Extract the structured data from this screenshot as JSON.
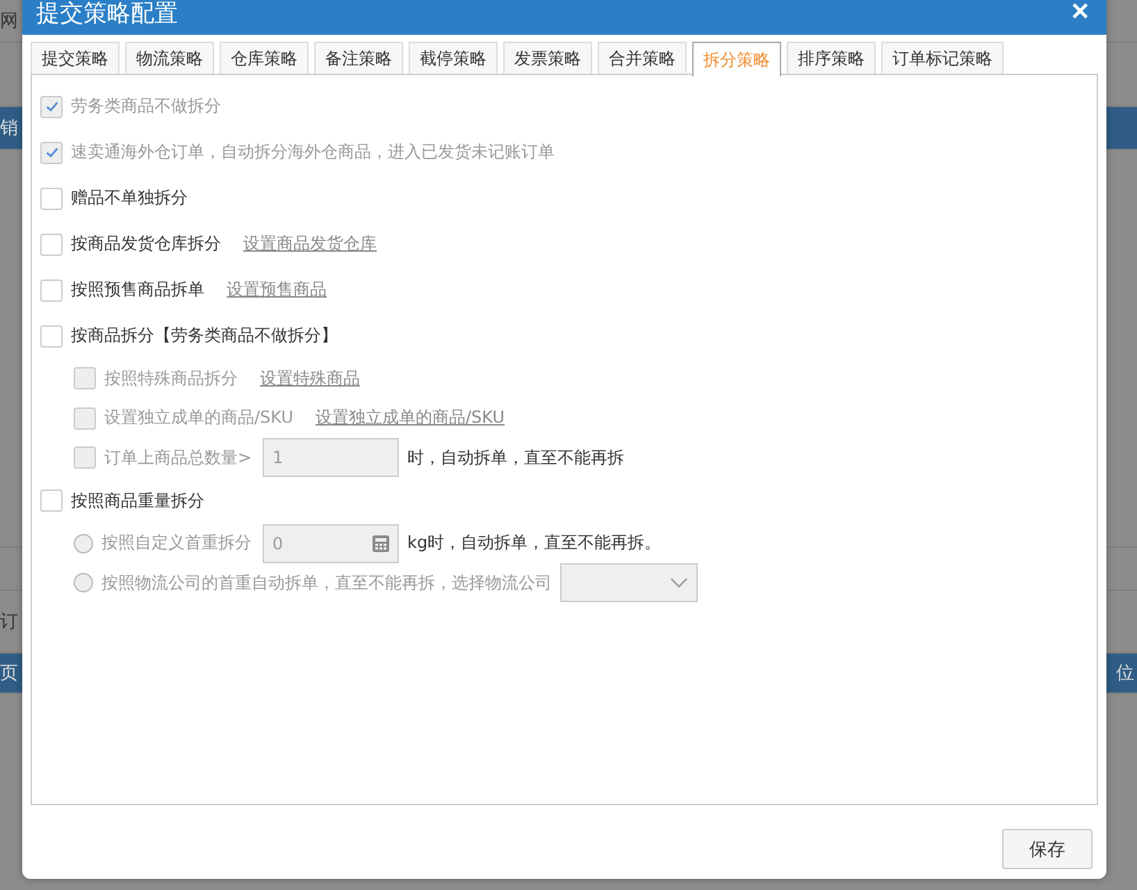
{
  "background": {
    "left_texts": [
      "网",
      "销",
      "订",
      "页"
    ],
    "right_texts": [
      "位"
    ]
  },
  "dialog": {
    "title": "提交策略配置",
    "close": "✕",
    "tabs": [
      {
        "label": "提交策略",
        "selected": false
      },
      {
        "label": "物流策略",
        "selected": false
      },
      {
        "label": "仓库策略",
        "selected": false
      },
      {
        "label": "备注策略",
        "selected": false
      },
      {
        "label": "截停策略",
        "selected": false
      },
      {
        "label": "发票策略",
        "selected": false
      },
      {
        "label": "合并策略",
        "selected": false
      },
      {
        "label": "拆分策略",
        "selected": true
      },
      {
        "label": "排序策略",
        "selected": false
      },
      {
        "label": "订单标记策略",
        "selected": false
      }
    ],
    "options": [
      {
        "kind": "checkbox",
        "label": "劳务类商品不做拆分",
        "checked": true,
        "disabled": true
      },
      {
        "kind": "checkbox",
        "label": "速卖通海外仓订单，自动拆分海外仓商品，进入已发货未记账订单",
        "checked": true,
        "disabled": true
      },
      {
        "kind": "checkbox",
        "label": "赠品不单独拆分",
        "checked": false,
        "disabled": false
      },
      {
        "kind": "checkbox",
        "label": "按商品发货仓库拆分",
        "checked": false,
        "disabled": false,
        "link": "设置商品发货仓库"
      },
      {
        "kind": "checkbox",
        "label": "按照预售商品拆单",
        "checked": false,
        "disabled": false,
        "link": "设置预售商品"
      },
      {
        "kind": "checkbox",
        "label": "按商品拆分【劳务类商品不做拆分】",
        "checked": false,
        "disabled": false,
        "children": [
          {
            "kind": "checkbox",
            "label": "按照特殊商品拆分",
            "checked": false,
            "disabled": true,
            "link": "设置特殊商品"
          },
          {
            "kind": "checkbox",
            "label": "设置独立成单的商品/SKU",
            "checked": false,
            "disabled": true,
            "link": "设置独立成单的商品/SKU"
          },
          {
            "kind": "checkbox",
            "label": "订单上商品总数量>",
            "checked": false,
            "disabled": true,
            "input": {
              "value": "1",
              "calculator": false
            },
            "suffix": "时，自动拆单，直至不能再拆"
          }
        ]
      },
      {
        "kind": "checkbox",
        "label": "按照商品重量拆分",
        "checked": false,
        "disabled": false,
        "children": [
          {
            "kind": "radio",
            "label": "按照自定义首重拆分",
            "selected": false,
            "disabled": true,
            "input": {
              "value": "0",
              "calculator": true
            },
            "suffix": "kg时，自动拆单，直至不能再拆。"
          },
          {
            "kind": "radio",
            "label": "按照物流公司的首重自动拆单，直至不能再拆，选择物流公司",
            "selected": false,
            "disabled": true,
            "select": true
          }
        ]
      }
    ],
    "save": "保存"
  }
}
